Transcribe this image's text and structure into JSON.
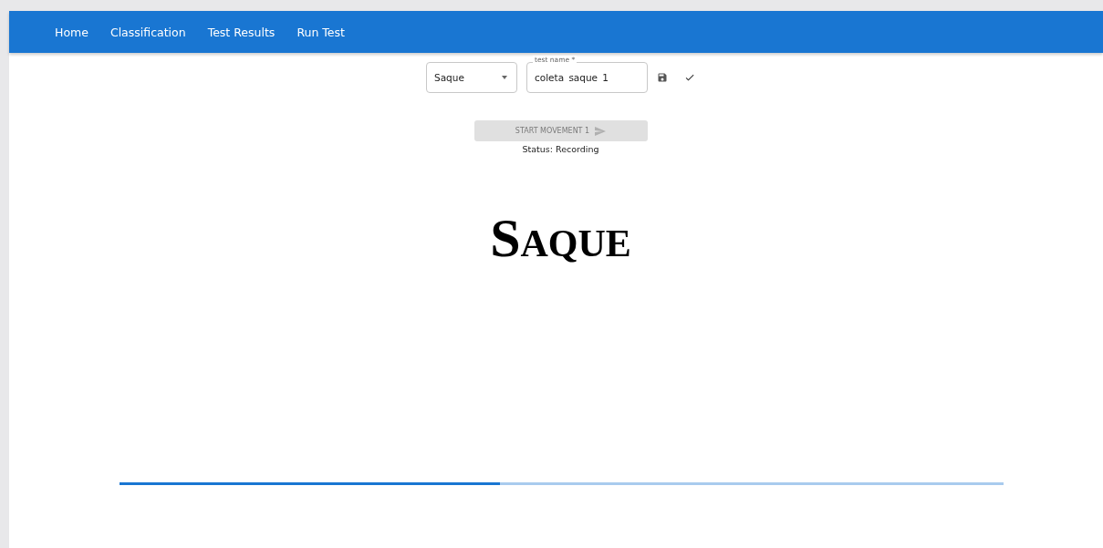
{
  "nav": {
    "items": [
      {
        "label": "Home"
      },
      {
        "label": "Classification"
      },
      {
        "label": "Test Results"
      },
      {
        "label": "Run Test"
      }
    ]
  },
  "form": {
    "movement_select": {
      "value": "Saque"
    },
    "test_name": {
      "label": "test name *",
      "value": "coleta_saque_1"
    }
  },
  "start_button": {
    "label": "START MOVEMENT 1",
    "disabled": true
  },
  "status": "Status: Recording",
  "movement_title": "Saque",
  "progress": {
    "level": 0.43
  }
}
